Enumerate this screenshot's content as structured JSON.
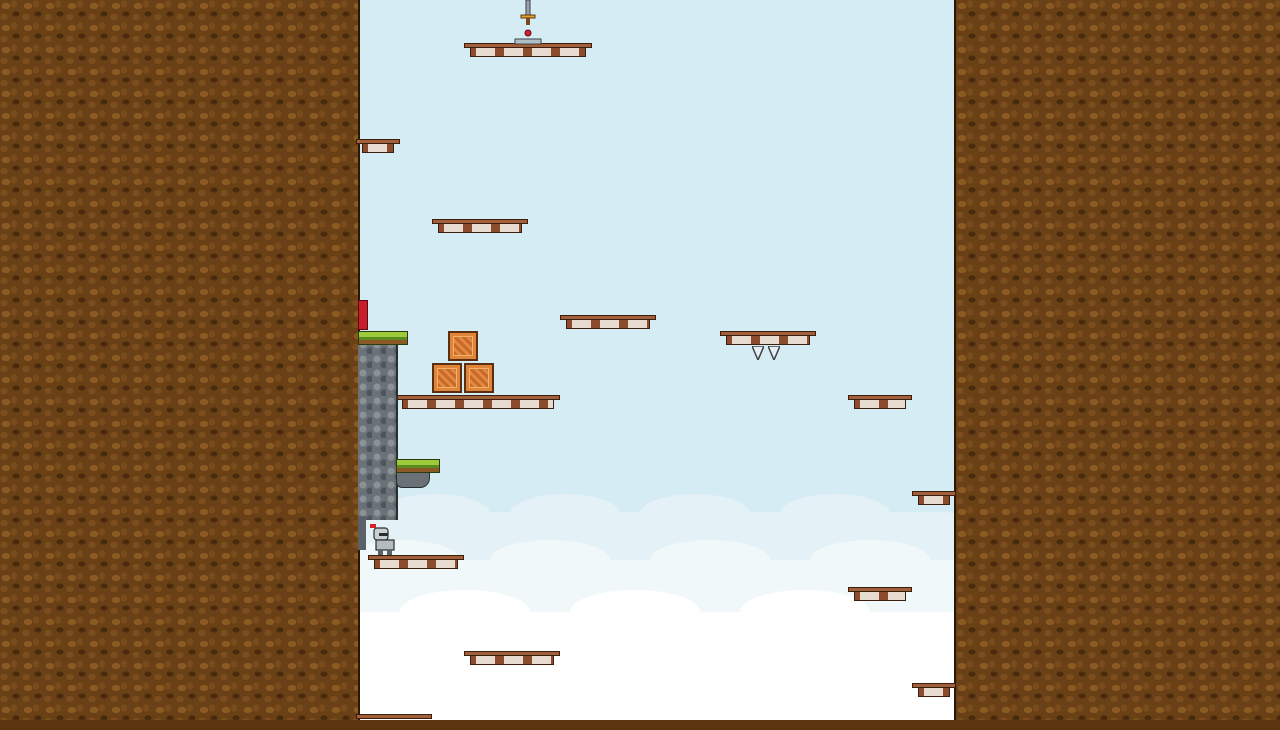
{
  "scene": {
    "colors": {
      "sky": "#d6ecf4",
      "cloud": "#ffffff",
      "dirt_wall": "#6a4016",
      "platform_wood": "#a2603a",
      "crate": "#e08438",
      "rock": "#6a7278",
      "grass": "#9ccc3c",
      "door": "#c81e2a"
    },
    "elements": {
      "player": "knight-player",
      "goal_item": "sword-icon",
      "hazard": "spike-icon",
      "door": "red-door",
      "crate_count": 3,
      "platform_count": 15
    }
  }
}
